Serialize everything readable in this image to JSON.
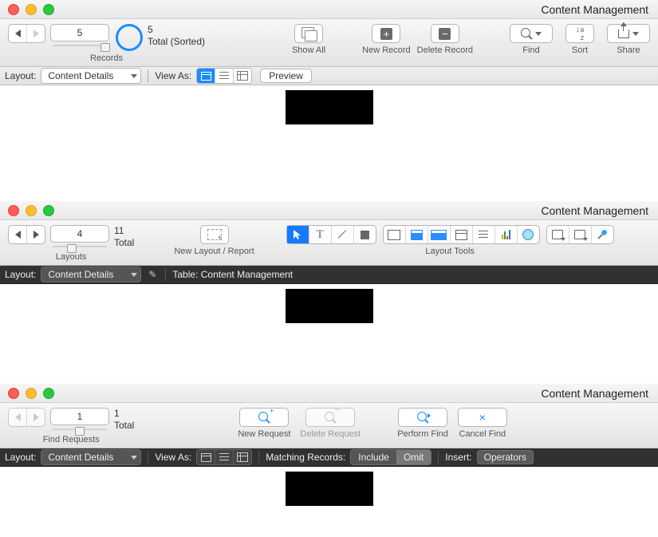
{
  "windows": [
    {
      "title": "Content Management",
      "nav": {
        "current": "5",
        "total": "5",
        "status": "Total (Sorted)",
        "section_label": "Records"
      },
      "slider_thumb_pct": 88,
      "toolbar": {
        "show_all": "Show All",
        "new_record": "New Record",
        "delete_record": "Delete Record",
        "find": "Find",
        "sort": "Sort",
        "share": "Share"
      },
      "subbar": {
        "layout_label": "Layout:",
        "layout_value": "Content Details",
        "view_as": "View As:",
        "preview": "Preview",
        "dark": false
      }
    },
    {
      "title": "Content Management",
      "nav": {
        "current": "4",
        "total": "11",
        "status": "Total",
        "section_label": "Layouts"
      },
      "slider_thumb_pct": 30,
      "toolbar": {
        "new_layout": "New Layout / Report",
        "layout_tools": "Layout Tools"
      },
      "subbar": {
        "layout_label": "Layout:",
        "layout_value": "Content Details",
        "table_label": "Table: Content Management",
        "dark": true
      }
    },
    {
      "title": "Content Management",
      "nav": {
        "current": "1",
        "total": "1",
        "status": "Total",
        "section_label": "Find Requests"
      },
      "slider_thumb_pct": 45,
      "toolbar": {
        "new_request": "New Request",
        "delete_request": "Delete Request",
        "perform_find": "Perform Find",
        "cancel_find": "Cancel Find"
      },
      "subbar": {
        "layout_label": "Layout:",
        "layout_value": "Content Details",
        "view_as": "View As:",
        "matching": "Matching Records:",
        "include": "Include",
        "omit": "Omit",
        "insert": "Insert:",
        "operators": "Operators",
        "dark": true
      }
    }
  ]
}
